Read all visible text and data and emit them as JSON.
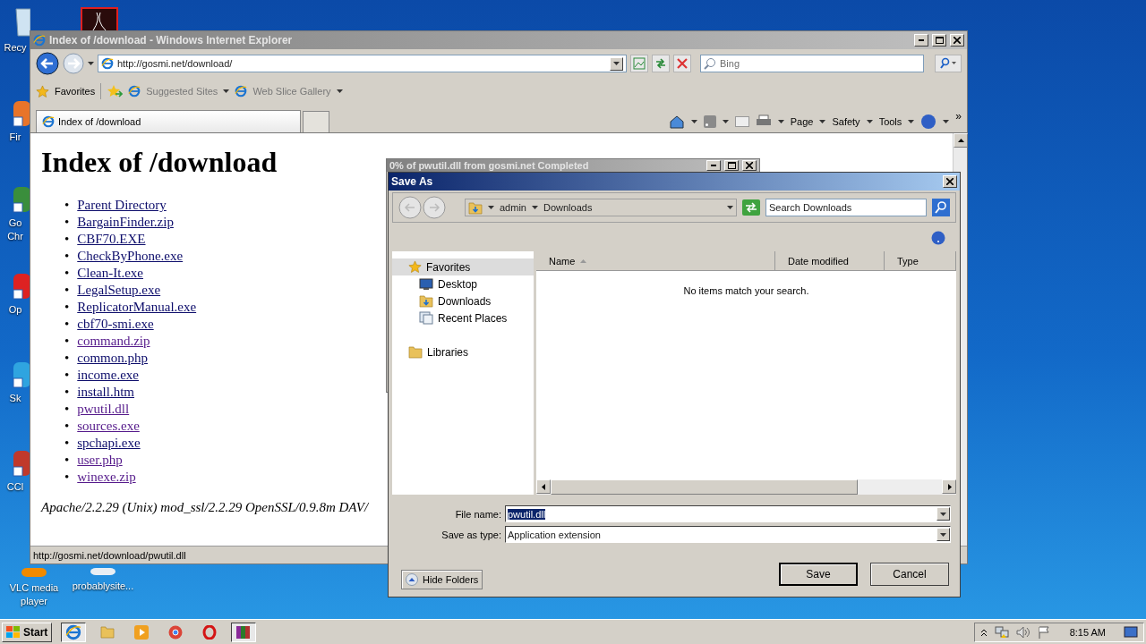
{
  "desktop": {
    "icons": [
      {
        "label": "Recy"
      },
      {
        "label": "Fir"
      },
      {
        "label": "Go Chr"
      },
      {
        "label": "Op"
      },
      {
        "label": "Sk"
      },
      {
        "label": "CCl"
      },
      {
        "label": "VLC media player"
      },
      {
        "label": "probablysite..."
      }
    ]
  },
  "browser": {
    "title": "Index of /download - Windows Internet Explorer",
    "address": "http://gosmi.net/download/",
    "search_placeholder": "Bing",
    "favorites": {
      "label": "Favorites",
      "items": [
        "Suggested Sites",
        "Web Slice Gallery"
      ]
    },
    "tab": {
      "title": "Index of /download"
    },
    "commands": [
      "Page",
      "Safety",
      "Tools"
    ],
    "overflow": "»",
    "page": {
      "heading": "Index of /download",
      "bullet": "•",
      "links": [
        {
          "text": "Parent Directory",
          "visited": false
        },
        {
          "text": "BargainFinder.zip",
          "visited": false
        },
        {
          "text": "CBF70.EXE",
          "visited": false
        },
        {
          "text": "CheckByPhone.exe",
          "visited": false
        },
        {
          "text": "Clean-It.exe",
          "visited": false
        },
        {
          "text": "LegalSetup.exe",
          "visited": false
        },
        {
          "text": "ReplicatorManual.exe",
          "visited": false
        },
        {
          "text": "cbf70-smi.exe",
          "visited": false
        },
        {
          "text": "command.zip",
          "visited": true
        },
        {
          "text": "common.php",
          "visited": false
        },
        {
          "text": "income.exe",
          "visited": false
        },
        {
          "text": "install.htm",
          "visited": false
        },
        {
          "text": "pwutil.dll",
          "visited": true
        },
        {
          "text": "sources.exe",
          "visited": true
        },
        {
          "text": "spchapi.exe",
          "visited": false
        },
        {
          "text": "user.php",
          "visited": true
        },
        {
          "text": "winexe.zip",
          "visited": true
        }
      ],
      "footer": "Apache/2.2.29 (Unix) mod_ssl/2.2.29 OpenSSL/0.9.8m DAV/"
    },
    "status": "http://gosmi.net/download/pwutil.dll"
  },
  "download_window": {
    "title": "0% of pwutil.dll from gosmi.net Completed"
  },
  "save_dialog": {
    "title": "Save As",
    "breadcrumb": [
      "admin",
      "Downloads"
    ],
    "search_placeholder": "Search Downloads",
    "nav": [
      {
        "label": "Favorites",
        "kind": "star",
        "selected": true,
        "children": [
          {
            "label": "Desktop",
            "kind": "desktop",
            "selected": false
          },
          {
            "label": "Downloads",
            "kind": "downloads",
            "selected": false
          },
          {
            "label": "Recent Places",
            "kind": "recent",
            "selected": false
          }
        ]
      },
      {
        "label": "Libraries",
        "kind": "library",
        "selected": false
      }
    ],
    "columns": [
      {
        "label": "Name",
        "sorted": true
      },
      {
        "label": "Date modified",
        "sorted": false
      },
      {
        "label": "Type",
        "sorted": false
      }
    ],
    "empty_message": "No items match your search.",
    "file_name_label": "File name:",
    "file_name": "pwutil.dll",
    "type_label": "Save as type:",
    "type": "Application extension",
    "hide_folders": "Hide Folders",
    "buttons": [
      "Save",
      "Cancel"
    ]
  },
  "taskbar": {
    "start": "Start",
    "clock": "8:15 AM"
  }
}
